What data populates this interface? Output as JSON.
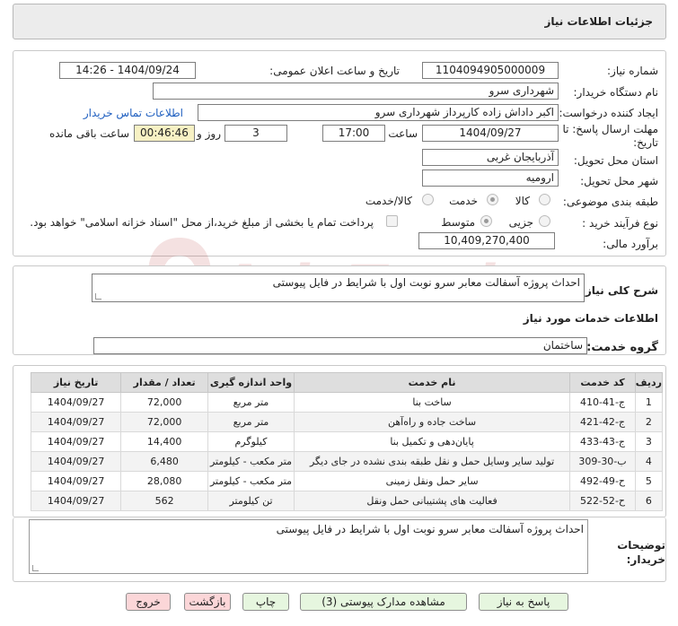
{
  "header": {
    "title": "جزئیات اطلاعات نیاز"
  },
  "form": {
    "need_number_label": "شماره نیاز:",
    "need_number": "1104094905000009",
    "announce_label": "تاریخ و ساعت اعلان عمومی:",
    "announce_value": "1404/09/24 - 14:26",
    "buyer_org_label": "نام دستگاه خریدار:",
    "buyer_org": "شهرداری سرو",
    "creator_label": "ایجاد کننده درخواست:",
    "creator": "اکبر داداش زاده کارپرداز شهرداری سرو",
    "contact_link": "اطلاعات تماس خریدار",
    "deadline_label": "مهلت ارسال پاسخ: تا تاریخ:",
    "deadline_date": "1404/09/27",
    "time_label": "ساعت",
    "deadline_time": "17:00",
    "days": "3",
    "days_label": "روز و",
    "remaining": "00:46:46",
    "remaining_label": "ساعت باقی مانده",
    "province_label": "استان محل تحویل:",
    "province": "آذربایجان غربی",
    "city_label": "شهر محل تحویل:",
    "city": "ارومیه",
    "category_label": "طبقه بندی موضوعی:",
    "category_options": [
      "کالا",
      "خدمت",
      "کالا/خدمت"
    ],
    "category_selected": "خدمت",
    "process_label": "نوع فرآیند خرید :",
    "process_options": [
      "جزیی",
      "متوسط"
    ],
    "process_selected": "متوسط",
    "payment_note": "پرداخت تمام یا بخشی از مبلغ خرید،از محل \"اسناد خزانه اسلامی\" خواهد بود.",
    "estimate_label": "برآورد مالی:",
    "estimate": "10,409,270,400"
  },
  "summary": {
    "label": "شرح کلی نیاز:",
    "text": "احداث پروژه آسفالت معابر سرو نوبت اول با شرایط در فایل پیوستی"
  },
  "services": {
    "section_title": "اطلاعات خدمات مورد نیاز",
    "group_label": "گروه خدمت:",
    "group_value": "ساختمان",
    "headers": [
      "ردیف",
      "کد خدمت",
      "نام خدمت",
      "واحد اندازه گیری",
      "تعداد / مقدار",
      "تاریخ نیاز"
    ],
    "rows": [
      [
        "1",
        "ج-41-410",
        "ساخت بنا",
        "متر مربع",
        "72,000",
        "1404/09/27"
      ],
      [
        "2",
        "ج-42-421",
        "ساخت جاده و راه‌آهن",
        "متر مربع",
        "72,000",
        "1404/09/27"
      ],
      [
        "3",
        "ج-43-433",
        "پایان‌دهی و تکمیل بنا",
        "کیلوگرم",
        "14,400",
        "1404/09/27"
      ],
      [
        "4",
        "ب-30-309",
        "تولید سایر وسایل حمل و نقل طبقه بندی نشده در جای دیگر",
        "متر مکعب - کیلومتر",
        "6,480",
        "1404/09/27"
      ],
      [
        "5",
        "ح-49-492",
        "سایر حمل ونقل زمینی",
        "متر مکعب - کیلومتر",
        "28,080",
        "1404/09/27"
      ],
      [
        "6",
        "ح-52-522",
        "فعالیت های پشتیبانی حمل ونقل",
        "تن کیلومتر",
        "562",
        "1404/09/27"
      ]
    ]
  },
  "buyer_notes": {
    "label": "توضیحات خریدار:",
    "text": "احداث پروژه آسفالت معابر سرو نوبت اول با شرایط در فایل پیوستی"
  },
  "buttons": {
    "reply": "پاسخ به نیاز",
    "attachments": "مشاهده مدارک پیوستی (3)",
    "print": "چاپ",
    "back": "بازگشت",
    "exit": "خروج"
  },
  "watermark": {
    "text": "AriaTender.neT"
  },
  "colors": {
    "link": "#2060c0",
    "remaining_bg": "#f7f1c4",
    "green_button": "#e6f6df",
    "pink_button": "#fbd6d8",
    "watermark": "#b02020"
  }
}
